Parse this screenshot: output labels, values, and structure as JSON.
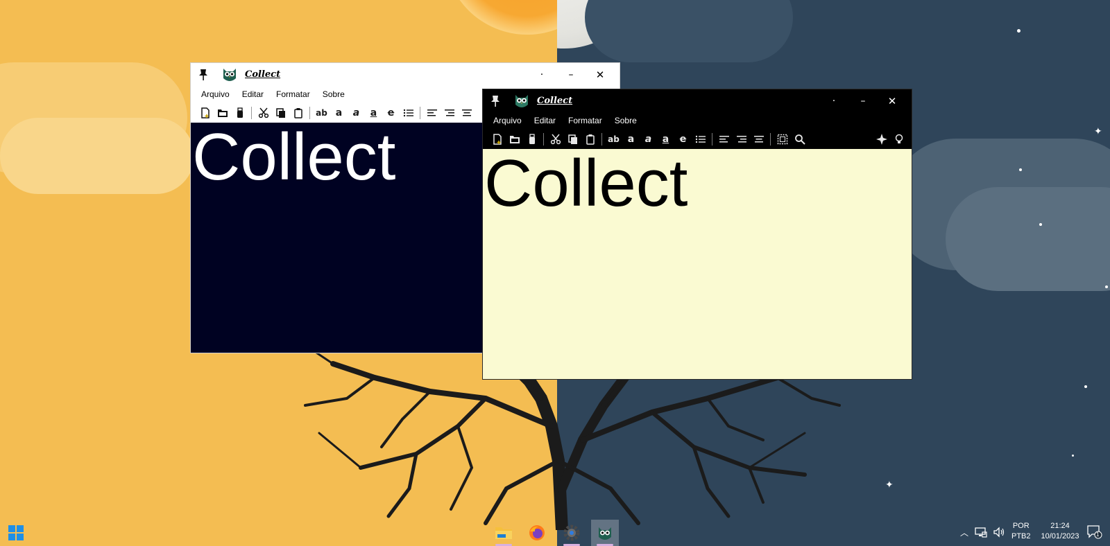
{
  "desktop": {
    "wallpaper_left_color": "#f4bd52",
    "wallpaper_right_color": "#2f455a"
  },
  "window_light": {
    "title": "Collect",
    "menu": [
      "Arquivo",
      "Editar",
      "Formatar",
      "Sobre"
    ],
    "editor_text": "Collect",
    "editor_bg": "#000222",
    "editor_fg": "#ffffff",
    "controls": {
      "dot": "·",
      "minimize": "–",
      "close": "✕"
    }
  },
  "window_dark": {
    "title": "Collect",
    "menu": [
      "Arquivo",
      "Editar",
      "Formatar",
      "Sobre"
    ],
    "editor_text": "Collect",
    "editor_bg": "#fafad2",
    "editor_fg": "#000000",
    "controls": {
      "dot": "·",
      "minimize": "–",
      "close": "✕"
    }
  },
  "toolbar_icons": [
    "new-file-icon",
    "open-folder-icon",
    "save-usb-icon",
    "cut-icon",
    "copy-icon",
    "paste-icon",
    "font-icon",
    "bold-icon",
    "italic-icon",
    "underline-icon",
    "strikethrough-icon",
    "bullet-list-icon",
    "align-left-icon",
    "align-right-icon",
    "align-center-icon",
    "select-all-icon",
    "search-icon",
    "sparkle-icon",
    "lightbulb-icon"
  ],
  "taskbar": {
    "apps": [
      "file-explorer-icon",
      "firefox-icon",
      "settings-icon",
      "collect-app-icon"
    ],
    "language": [
      "POR",
      "PTB2"
    ],
    "time": "21:24",
    "date": "10/01/2023",
    "notification_count": "1"
  }
}
